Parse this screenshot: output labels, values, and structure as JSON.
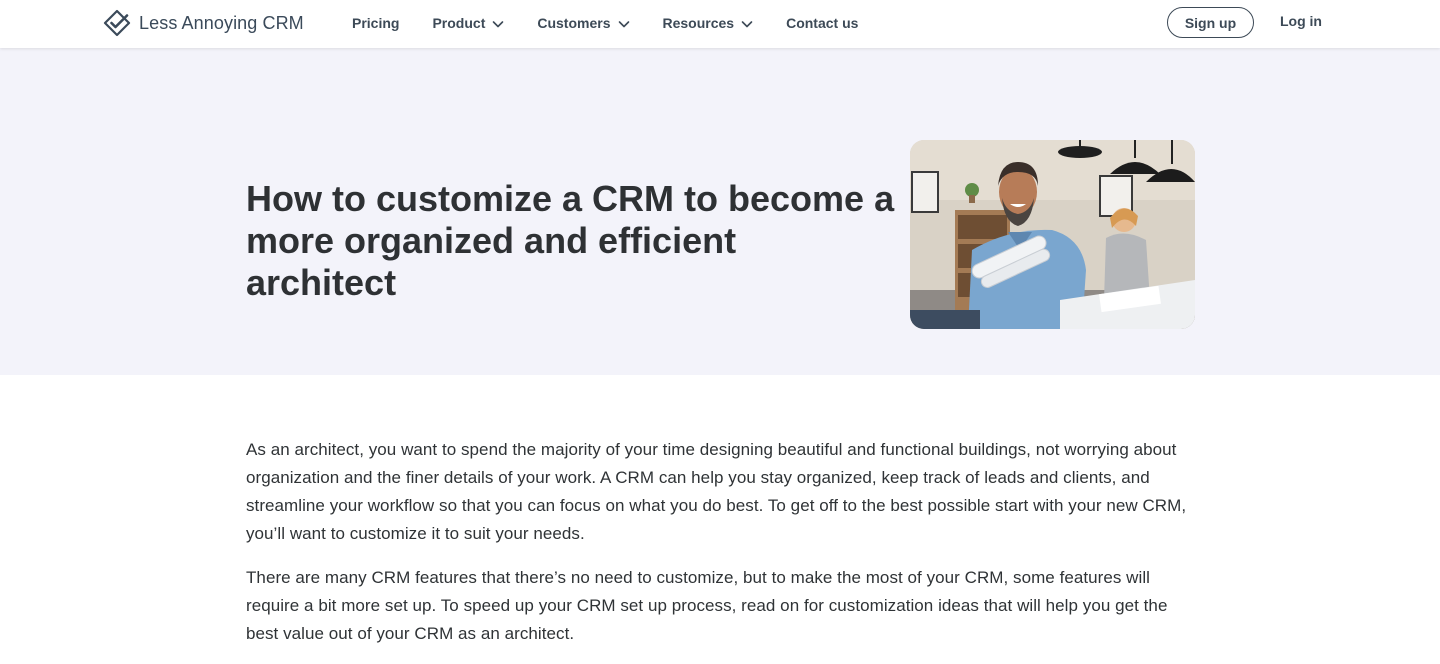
{
  "header": {
    "logo_text": "Less Annoying CRM",
    "logo_icon": "checkmark-diamond-icon",
    "nav": [
      {
        "label": "Pricing",
        "has_dropdown": false
      },
      {
        "label": "Product",
        "has_dropdown": true
      },
      {
        "label": "Customers",
        "has_dropdown": true
      },
      {
        "label": "Resources",
        "has_dropdown": true
      },
      {
        "label": "Contact us",
        "has_dropdown": false
      }
    ],
    "signup_label": "Sign up",
    "login_label": "Log in"
  },
  "hero": {
    "title": "How to customize a CRM to become a more organized and efficient architect",
    "image_alt": "Smiling architect holding rolled blueprints in an office"
  },
  "article": {
    "paragraphs": [
      "As an architect, you want to spend the majority of your time designing beautiful and functional buildings, not worrying about organization and the finer details of your work. A CRM can help you stay organized, keep track of leads and clients, and streamline your workflow so that you can focus on what you do best. To get off to the best possible start with your new CRM, you’ll want to customize it to suit your needs.",
      "There are many CRM features that there’s no need to customize, but to make the most of your CRM, some features will require a bit more set up. To speed up your CRM set up process, read on for customization ideas that will help you get the best value out of your CRM as an architect."
    ]
  },
  "colors": {
    "hero_background": "#f3f3fa",
    "nav_text": "#3d4a57",
    "heading_text": "#2e3134"
  }
}
